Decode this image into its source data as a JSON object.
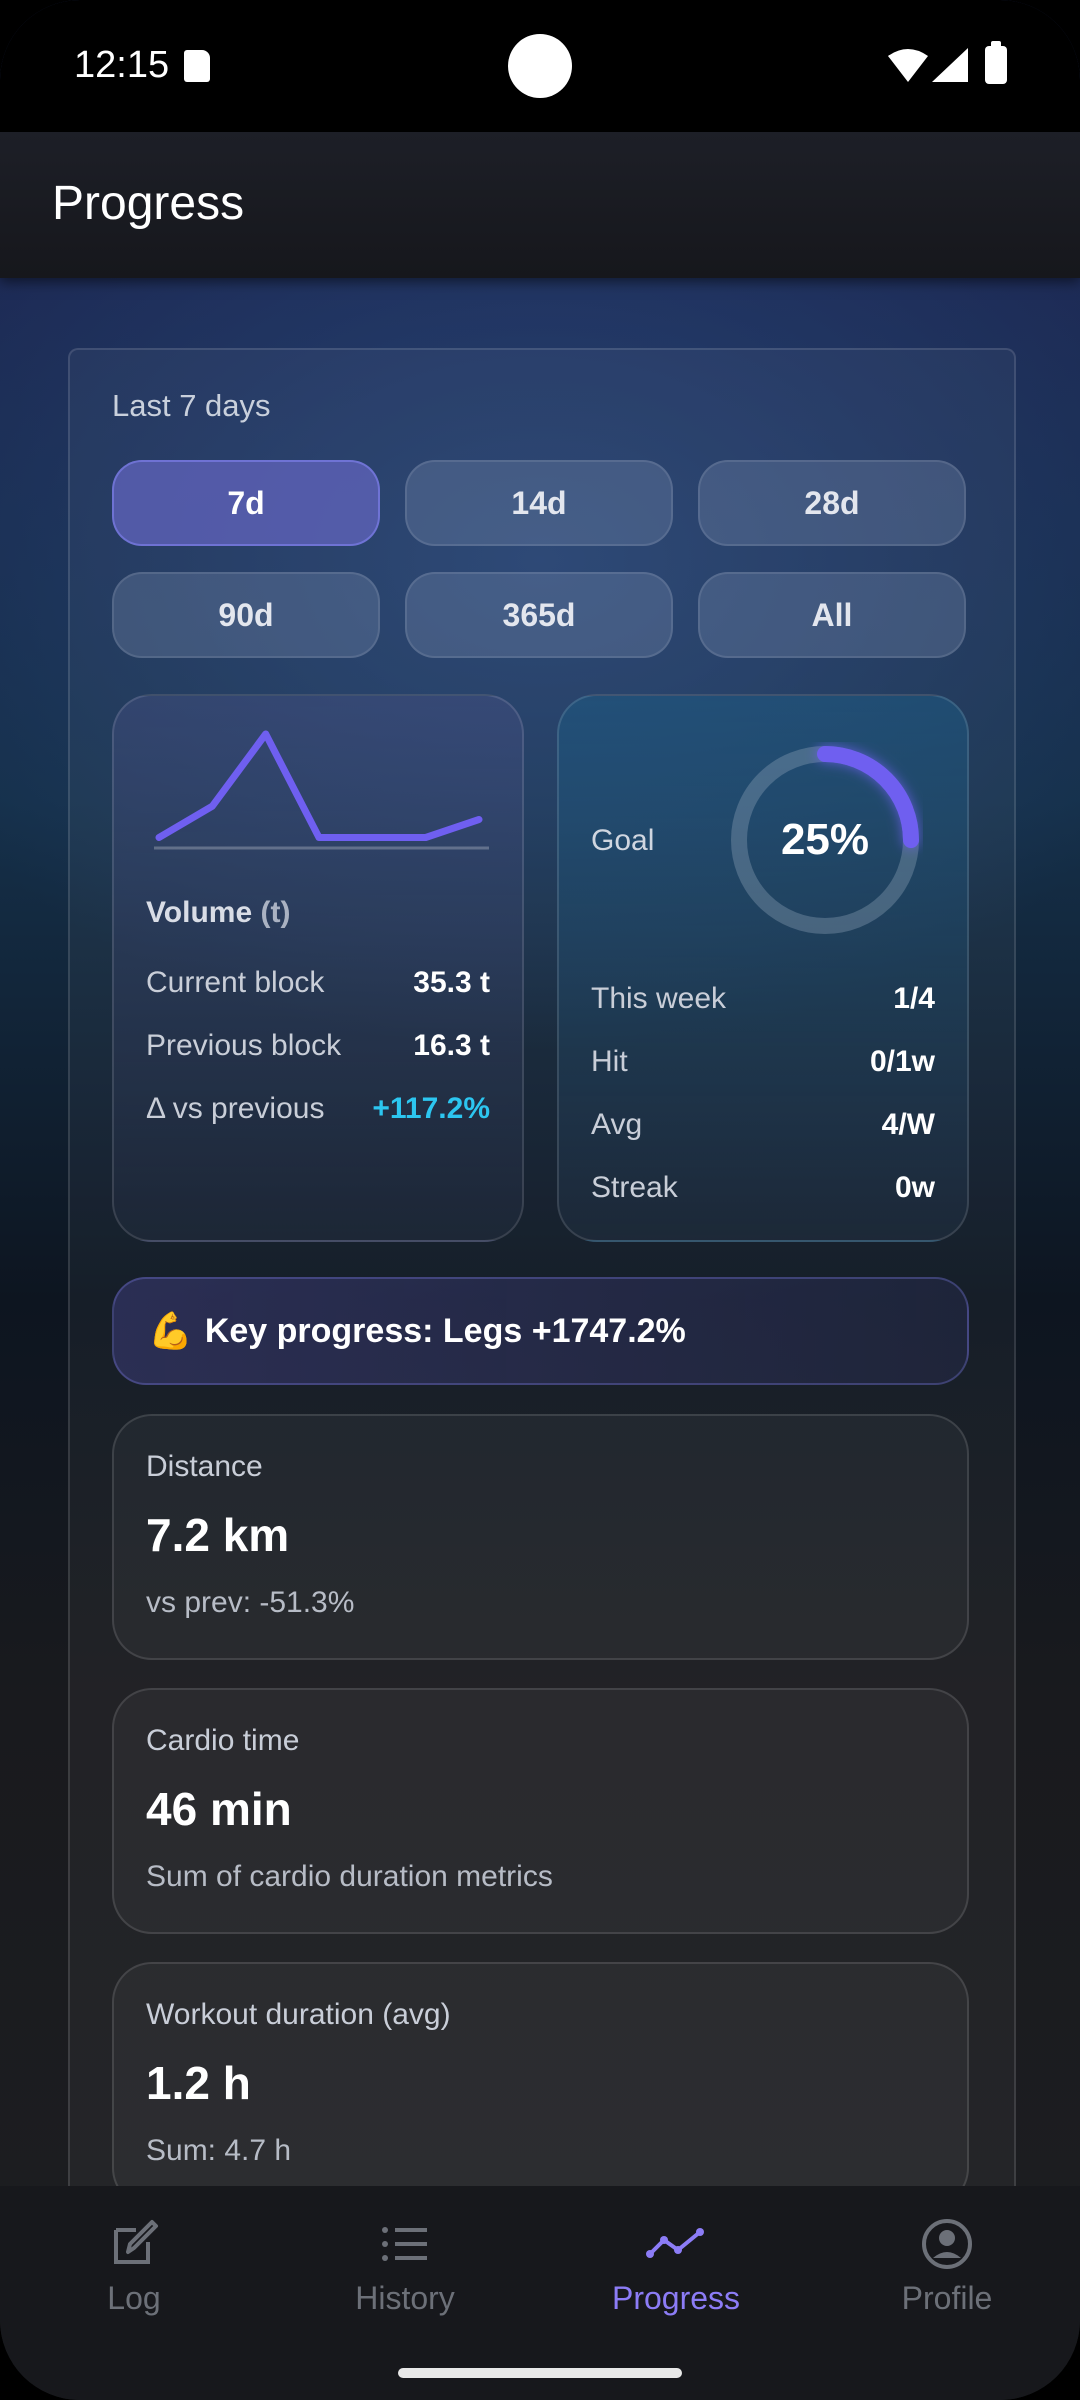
{
  "status_bar": {
    "time": "12:15"
  },
  "app_bar": {
    "title": "Progress"
  },
  "range": {
    "label": "Last 7 days",
    "chips": [
      "7d",
      "14d",
      "28d",
      "90d",
      "365d",
      "All"
    ],
    "selected": "7d"
  },
  "volume_card": {
    "title": "Volume",
    "unit": "(t)",
    "sparkline": [
      0.55,
      2.2,
      6.0,
      0.55,
      0.55,
      0.55,
      1.5
    ],
    "rows": [
      {
        "label": "Current block",
        "value": "35.3 t"
      },
      {
        "label": "Previous block",
        "value": "16.3 t"
      },
      {
        "label": "Δ vs previous",
        "value": "+117.2%"
      }
    ]
  },
  "goal_card": {
    "label": "Goal",
    "percent_text": "25%",
    "progress": 0.25,
    "rows": [
      {
        "label": "This week",
        "value": "1/4"
      },
      {
        "label": "Hit",
        "value": "0/1w"
      },
      {
        "label": "Avg",
        "value": "4/W"
      },
      {
        "label": "Streak",
        "value": "0w"
      }
    ]
  },
  "key_progress": {
    "emoji": "💪",
    "text": "Key progress: Legs +1747.2%"
  },
  "stats": [
    {
      "title": "Distance",
      "value": "7.2 km",
      "sub": "vs prev: -51.3%"
    },
    {
      "title": "Cardio time",
      "value": "46 min",
      "sub": "Sum of cardio duration metrics"
    },
    {
      "title": "Workout duration (avg)",
      "value": "1.2 h",
      "sub": "Sum: 4.7 h"
    }
  ],
  "bottom_nav": [
    {
      "label": "Log",
      "icon": "edit-icon"
    },
    {
      "label": "History",
      "icon": "list-icon"
    },
    {
      "label": "Progress",
      "icon": "trend-icon",
      "active": true
    },
    {
      "label": "Profile",
      "icon": "account-circle-icon"
    }
  ],
  "colors": {
    "accent": "#6f5ff0",
    "delta_positive": "#2cc6f0",
    "nav_active": "#8c7cf6"
  }
}
